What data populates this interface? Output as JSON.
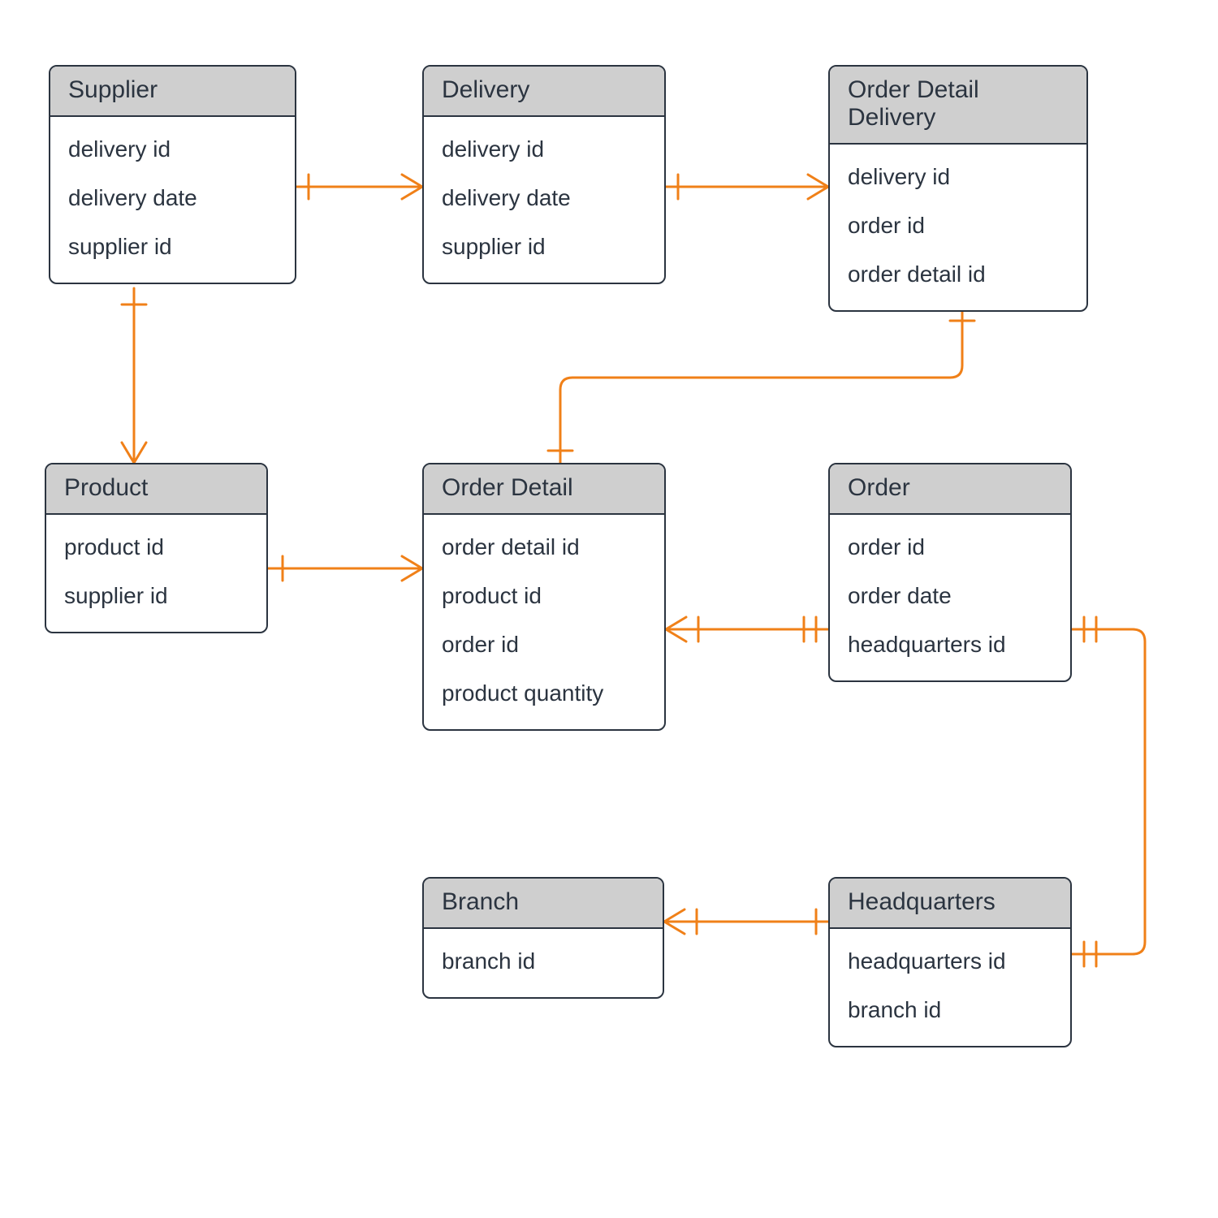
{
  "colors": {
    "connector": "#f08018",
    "border": "#2b3440",
    "header_fill": "#cfcfcf",
    "background": "#ffffff"
  },
  "entities": {
    "supplier": {
      "title": "Supplier",
      "fields": [
        "delivery id",
        "delivery date",
        "supplier id"
      ]
    },
    "delivery": {
      "title": "Delivery",
      "fields": [
        "delivery id",
        "delivery date",
        "supplier id"
      ]
    },
    "order_detail_delivery": {
      "title": "Order Detail Delivery",
      "fields": [
        "delivery id",
        "order id",
        "order detail id"
      ]
    },
    "product": {
      "title": "Product",
      "fields": [
        "product id",
        "supplier id"
      ]
    },
    "order_detail": {
      "title": "Order Detail",
      "fields": [
        "order detail id",
        "product id",
        "order id",
        "product quantity"
      ]
    },
    "order": {
      "title": "Order",
      "fields": [
        "order id",
        "order date",
        "headquarters id"
      ]
    },
    "branch": {
      "title": "Branch",
      "fields": [
        "branch id"
      ]
    },
    "headquarters": {
      "title": "Headquarters",
      "fields": [
        "headquarters id",
        "branch id"
      ]
    }
  },
  "relationships": [
    {
      "from": "supplier",
      "to": "delivery",
      "cardinality": "one-to-many"
    },
    {
      "from": "delivery",
      "to": "order_detail_delivery",
      "cardinality": "one-to-many"
    },
    {
      "from": "supplier",
      "to": "product",
      "cardinality": "one-to-many"
    },
    {
      "from": "product",
      "to": "order_detail",
      "cardinality": "one-to-many"
    },
    {
      "from": "order",
      "to": "order_detail",
      "cardinality": "one-to-many"
    },
    {
      "from": "order_detail",
      "to": "order_detail_delivery",
      "cardinality": "one-to-many"
    },
    {
      "from": "headquarters",
      "to": "order",
      "cardinality": "one-to-one"
    },
    {
      "from": "headquarters",
      "to": "branch",
      "cardinality": "one-to-many"
    }
  ]
}
